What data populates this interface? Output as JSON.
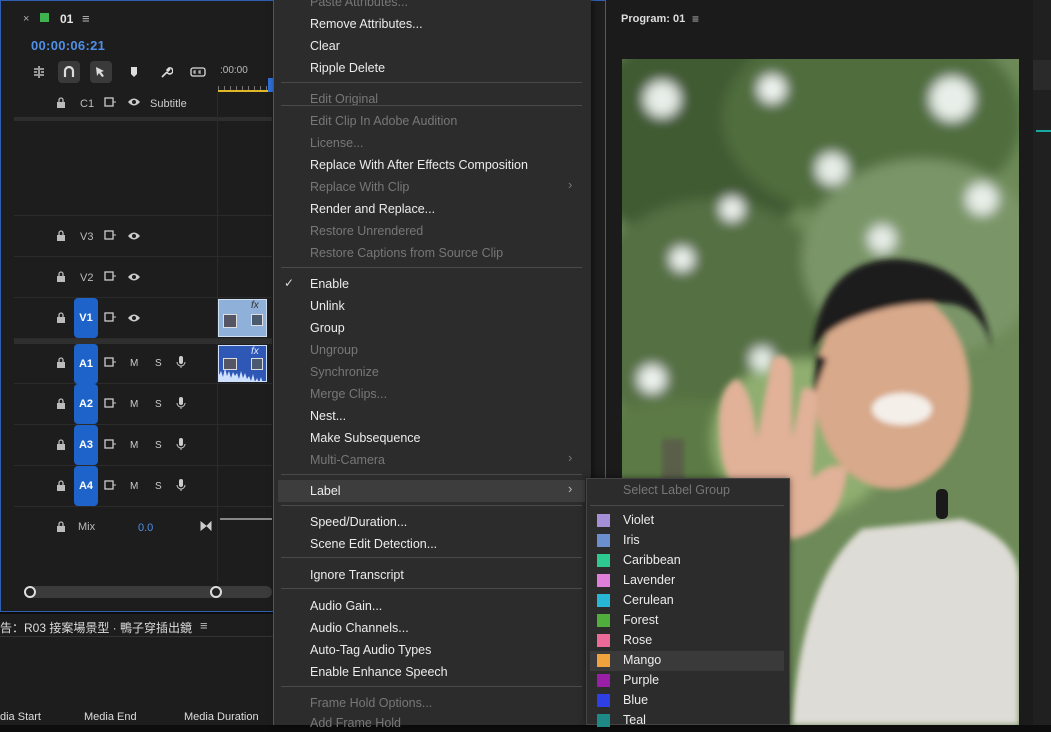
{
  "timeline": {
    "close": "×",
    "name": "01",
    "menu": "≡",
    "timecode": "00:00:06:21",
    "ruler_label": ":00:00",
    "tracks": [
      {
        "lock": "🔒",
        "id": "C1",
        "label": "Subtitle"
      },
      {
        "lock": "🔒",
        "id": "V3"
      },
      {
        "lock": "🔒",
        "id": "V2"
      },
      {
        "lock": "🔒",
        "id": "V1"
      },
      {
        "lock": "🔒",
        "id": "A1",
        "m": "M",
        "s": "S"
      },
      {
        "lock": "🔒",
        "id": "A2",
        "m": "M",
        "s": "S"
      },
      {
        "lock": "🔒",
        "id": "A3",
        "m": "M",
        "s": "S"
      },
      {
        "lock": "🔒",
        "id": "A4",
        "m": "M",
        "s": "S"
      }
    ],
    "mix": {
      "label": "Mix",
      "value": "0.0"
    },
    "fx": "fx"
  },
  "bottom_panel": {
    "title": "告：R03 接案場景型 · 鴨子穿插出鏡",
    "menu": "≡",
    "columns": [
      "dia Start",
      "Media End",
      "Media Duration"
    ]
  },
  "program": {
    "title": "Program: 01",
    "menu": "≡"
  },
  "context_menu": {
    "items": [
      {
        "label": "Paste Attributes...",
        "disabled": true
      },
      {
        "label": "Remove Attributes...",
        "disabled": false
      },
      {
        "label": "Clear",
        "disabled": false
      },
      {
        "label": "Ripple Delete",
        "disabled": false
      },
      {
        "label": "Edit Original",
        "disabled": true
      },
      {
        "label": "Edit Clip In Adobe Audition",
        "disabled": true
      },
      {
        "label": "License...",
        "disabled": true
      },
      {
        "label": "Replace With After Effects Composition",
        "disabled": false
      },
      {
        "label": "Replace With Clip",
        "disabled": true,
        "submenu": true
      },
      {
        "label": "Render and Replace...",
        "disabled": false
      },
      {
        "label": "Restore Unrendered",
        "disabled": true
      },
      {
        "label": "Restore Captions from Source Clip",
        "disabled": true
      },
      {
        "label": "Enable",
        "disabled": false,
        "checked": true
      },
      {
        "label": "Unlink",
        "disabled": false
      },
      {
        "label": "Group",
        "disabled": false
      },
      {
        "label": "Ungroup",
        "disabled": true
      },
      {
        "label": "Synchronize",
        "disabled": true
      },
      {
        "label": "Merge Clips...",
        "disabled": true
      },
      {
        "label": "Nest...",
        "disabled": false
      },
      {
        "label": "Make Subsequence",
        "disabled": false
      },
      {
        "label": "Multi-Camera",
        "disabled": true,
        "submenu": true
      },
      {
        "label": "Label",
        "disabled": false,
        "submenu": true,
        "highlighted": true
      },
      {
        "label": "Speed/Duration...",
        "disabled": false
      },
      {
        "label": "Scene Edit Detection...",
        "disabled": false
      },
      {
        "label": "Ignore Transcript",
        "disabled": false
      },
      {
        "label": "Audio Gain...",
        "disabled": false
      },
      {
        "label": "Audio Channels...",
        "disabled": false
      },
      {
        "label": "Auto-Tag Audio Types",
        "disabled": false
      },
      {
        "label": "Enable Enhance Speech",
        "disabled": false
      },
      {
        "label": "Frame Hold Options...",
        "disabled": true
      },
      {
        "label": "Add Frame Hold",
        "disabled": true
      }
    ],
    "check_glyph": "✓",
    "arrow_glyph": "›"
  },
  "label_submenu": {
    "header": "Select Label Group",
    "items": [
      {
        "label": "Violet",
        "color": "#a58fd6"
      },
      {
        "label": "Iris",
        "color": "#6b8fce"
      },
      {
        "label": "Caribbean",
        "color": "#2ec98f"
      },
      {
        "label": "Lavender",
        "color": "#e07fd9"
      },
      {
        "label": "Cerulean",
        "color": "#27b6d6"
      },
      {
        "label": "Forest",
        "color": "#4fae3c"
      },
      {
        "label": "Rose",
        "color": "#ec6a9a"
      },
      {
        "label": "Mango",
        "color": "#f0a33c",
        "hovered": true
      },
      {
        "label": "Purple",
        "color": "#9b1fa6"
      },
      {
        "label": "Blue",
        "color": "#2f3fe6"
      },
      {
        "label": "Teal",
        "color": "#1d8a88"
      }
    ]
  }
}
